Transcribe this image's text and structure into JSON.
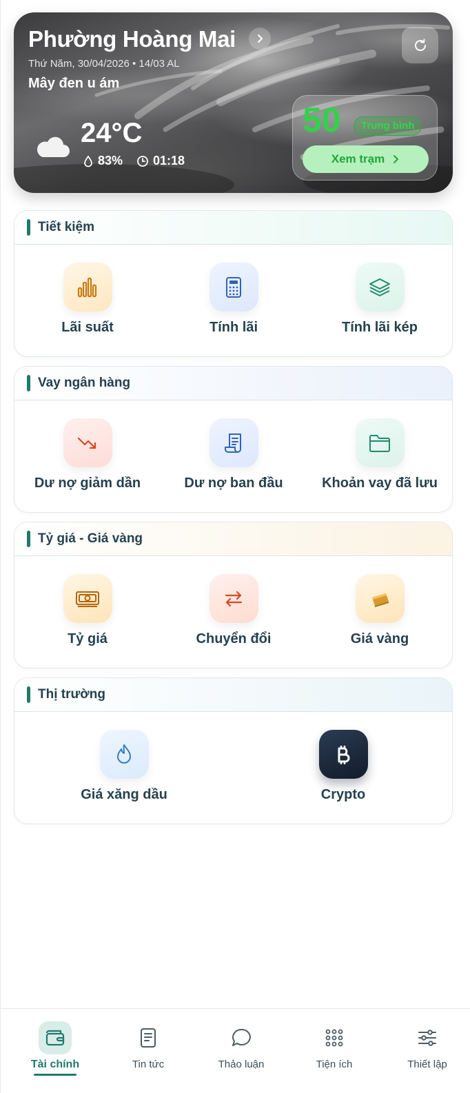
{
  "weather": {
    "location": "Phường Hoàng Mai",
    "date": "Thứ Năm, 30/04/2026 • 14/03 AL",
    "description": "Mây đen u ám",
    "temperature": "24°C",
    "humidity": "83%",
    "time": "01:18",
    "aqi": {
      "value": "50",
      "level": "Trung bình",
      "button_label": "Xem trạm"
    }
  },
  "sections": [
    {
      "title": "Tiết kiệm",
      "items": [
        {
          "label": "Lãi suất",
          "icon": "bar-chart-icon"
        },
        {
          "label": "Tính lãi",
          "icon": "calculator-icon"
        },
        {
          "label": "Tính lãi kép",
          "icon": "layers-icon"
        }
      ]
    },
    {
      "title": "Vay ngân hàng",
      "items": [
        {
          "label": "Dư nợ giảm dần",
          "icon": "trend-down-icon"
        },
        {
          "label": "Dư nợ ban đầu",
          "icon": "receipt-icon"
        },
        {
          "label": "Khoản vay đã lưu",
          "icon": "folder-icon"
        }
      ]
    },
    {
      "title": "Tỷ giá - Giá vàng",
      "items": [
        {
          "label": "Tỷ giá",
          "icon": "banknote-icon"
        },
        {
          "label": "Chuyển đổi",
          "icon": "exchange-icon"
        },
        {
          "label": "Giá vàng",
          "icon": "gold-bar-icon"
        }
      ]
    },
    {
      "title": "Thị trường",
      "items": [
        {
          "label": "Giá xăng dầu",
          "icon": "flame-icon"
        },
        {
          "label": "Crypto",
          "icon": "bitcoin-icon"
        }
      ]
    }
  ],
  "nav": [
    {
      "label": "Tài chính",
      "icon": "wallet-icon",
      "active": true
    },
    {
      "label": "Tin tức",
      "icon": "news-icon",
      "active": false
    },
    {
      "label": "Thảo luận",
      "icon": "chat-icon",
      "active": false
    },
    {
      "label": "Tiện ích",
      "icon": "grid-icon",
      "active": false
    },
    {
      "label": "Thiết lập",
      "icon": "sliders-icon",
      "active": false
    }
  ],
  "colors": {
    "accent": "#1f7a6c",
    "aqi_green": "#33d14a",
    "text_dark": "#24414f"
  }
}
